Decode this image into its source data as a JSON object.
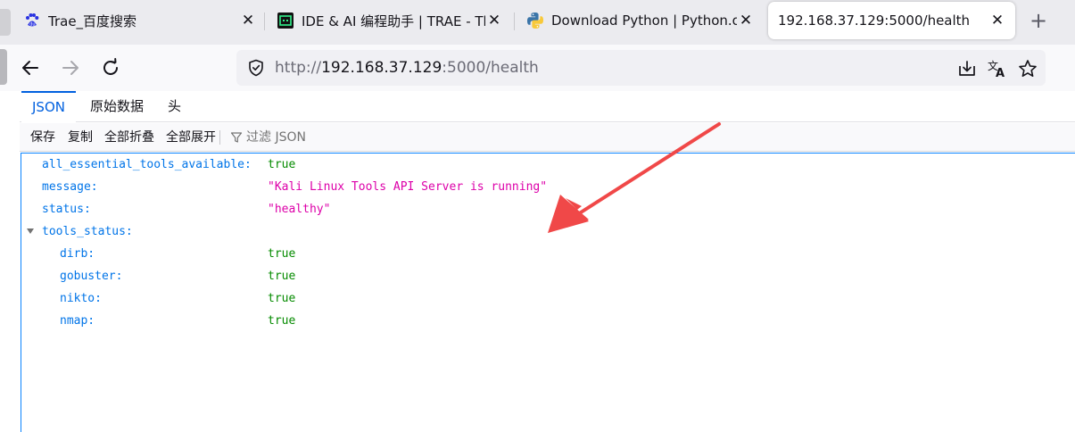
{
  "tabs": [
    {
      "title": "Trae_百度搜索",
      "icon": "baidu-paw-icon"
    },
    {
      "title": "IDE & AI 编程助手 | TRAE - The",
      "icon": "trae-logo-icon"
    },
    {
      "title": "Download Python | Python.org",
      "icon": "python-logo-icon"
    },
    {
      "title": "192.168.37.129:5000/health",
      "icon": "none",
      "active": true
    }
  ],
  "urlbar": {
    "scheme": "http://",
    "host": "192.168.37.129",
    "rest": ":5000/health"
  },
  "viewer_tabs": [
    "JSON",
    "原始数据",
    "头"
  ],
  "toolbar": {
    "save": "保存",
    "copy": "复制",
    "collapse_all": "全部折叠",
    "expand_all": "全部展开",
    "filter": "过滤 JSON"
  },
  "json_rows": [
    {
      "key": "all_essential_tools_available:",
      "value": "true",
      "type": "bool",
      "indent": 0
    },
    {
      "key": "message:",
      "value": "\"Kali Linux Tools API Server is running\"",
      "type": "str",
      "indent": 0
    },
    {
      "key": "status:",
      "value": "\"healthy\"",
      "type": "str",
      "indent": 0
    },
    {
      "key": "tools_status:",
      "value": "",
      "type": "object",
      "indent": 0,
      "expanded": true
    },
    {
      "key": "dirb:",
      "value": "true",
      "type": "bool",
      "indent": 1
    },
    {
      "key": "gobuster:",
      "value": "true",
      "type": "bool",
      "indent": 1
    },
    {
      "key": "nikto:",
      "value": "true",
      "type": "bool",
      "indent": 1
    },
    {
      "key": "nmap:",
      "value": "true",
      "type": "bool",
      "indent": 1
    }
  ],
  "colors": {
    "accent": "#0060df",
    "key": "#0074e8",
    "bool": "#058b00",
    "string": "#dd00a9",
    "arrow": "#f04848"
  }
}
